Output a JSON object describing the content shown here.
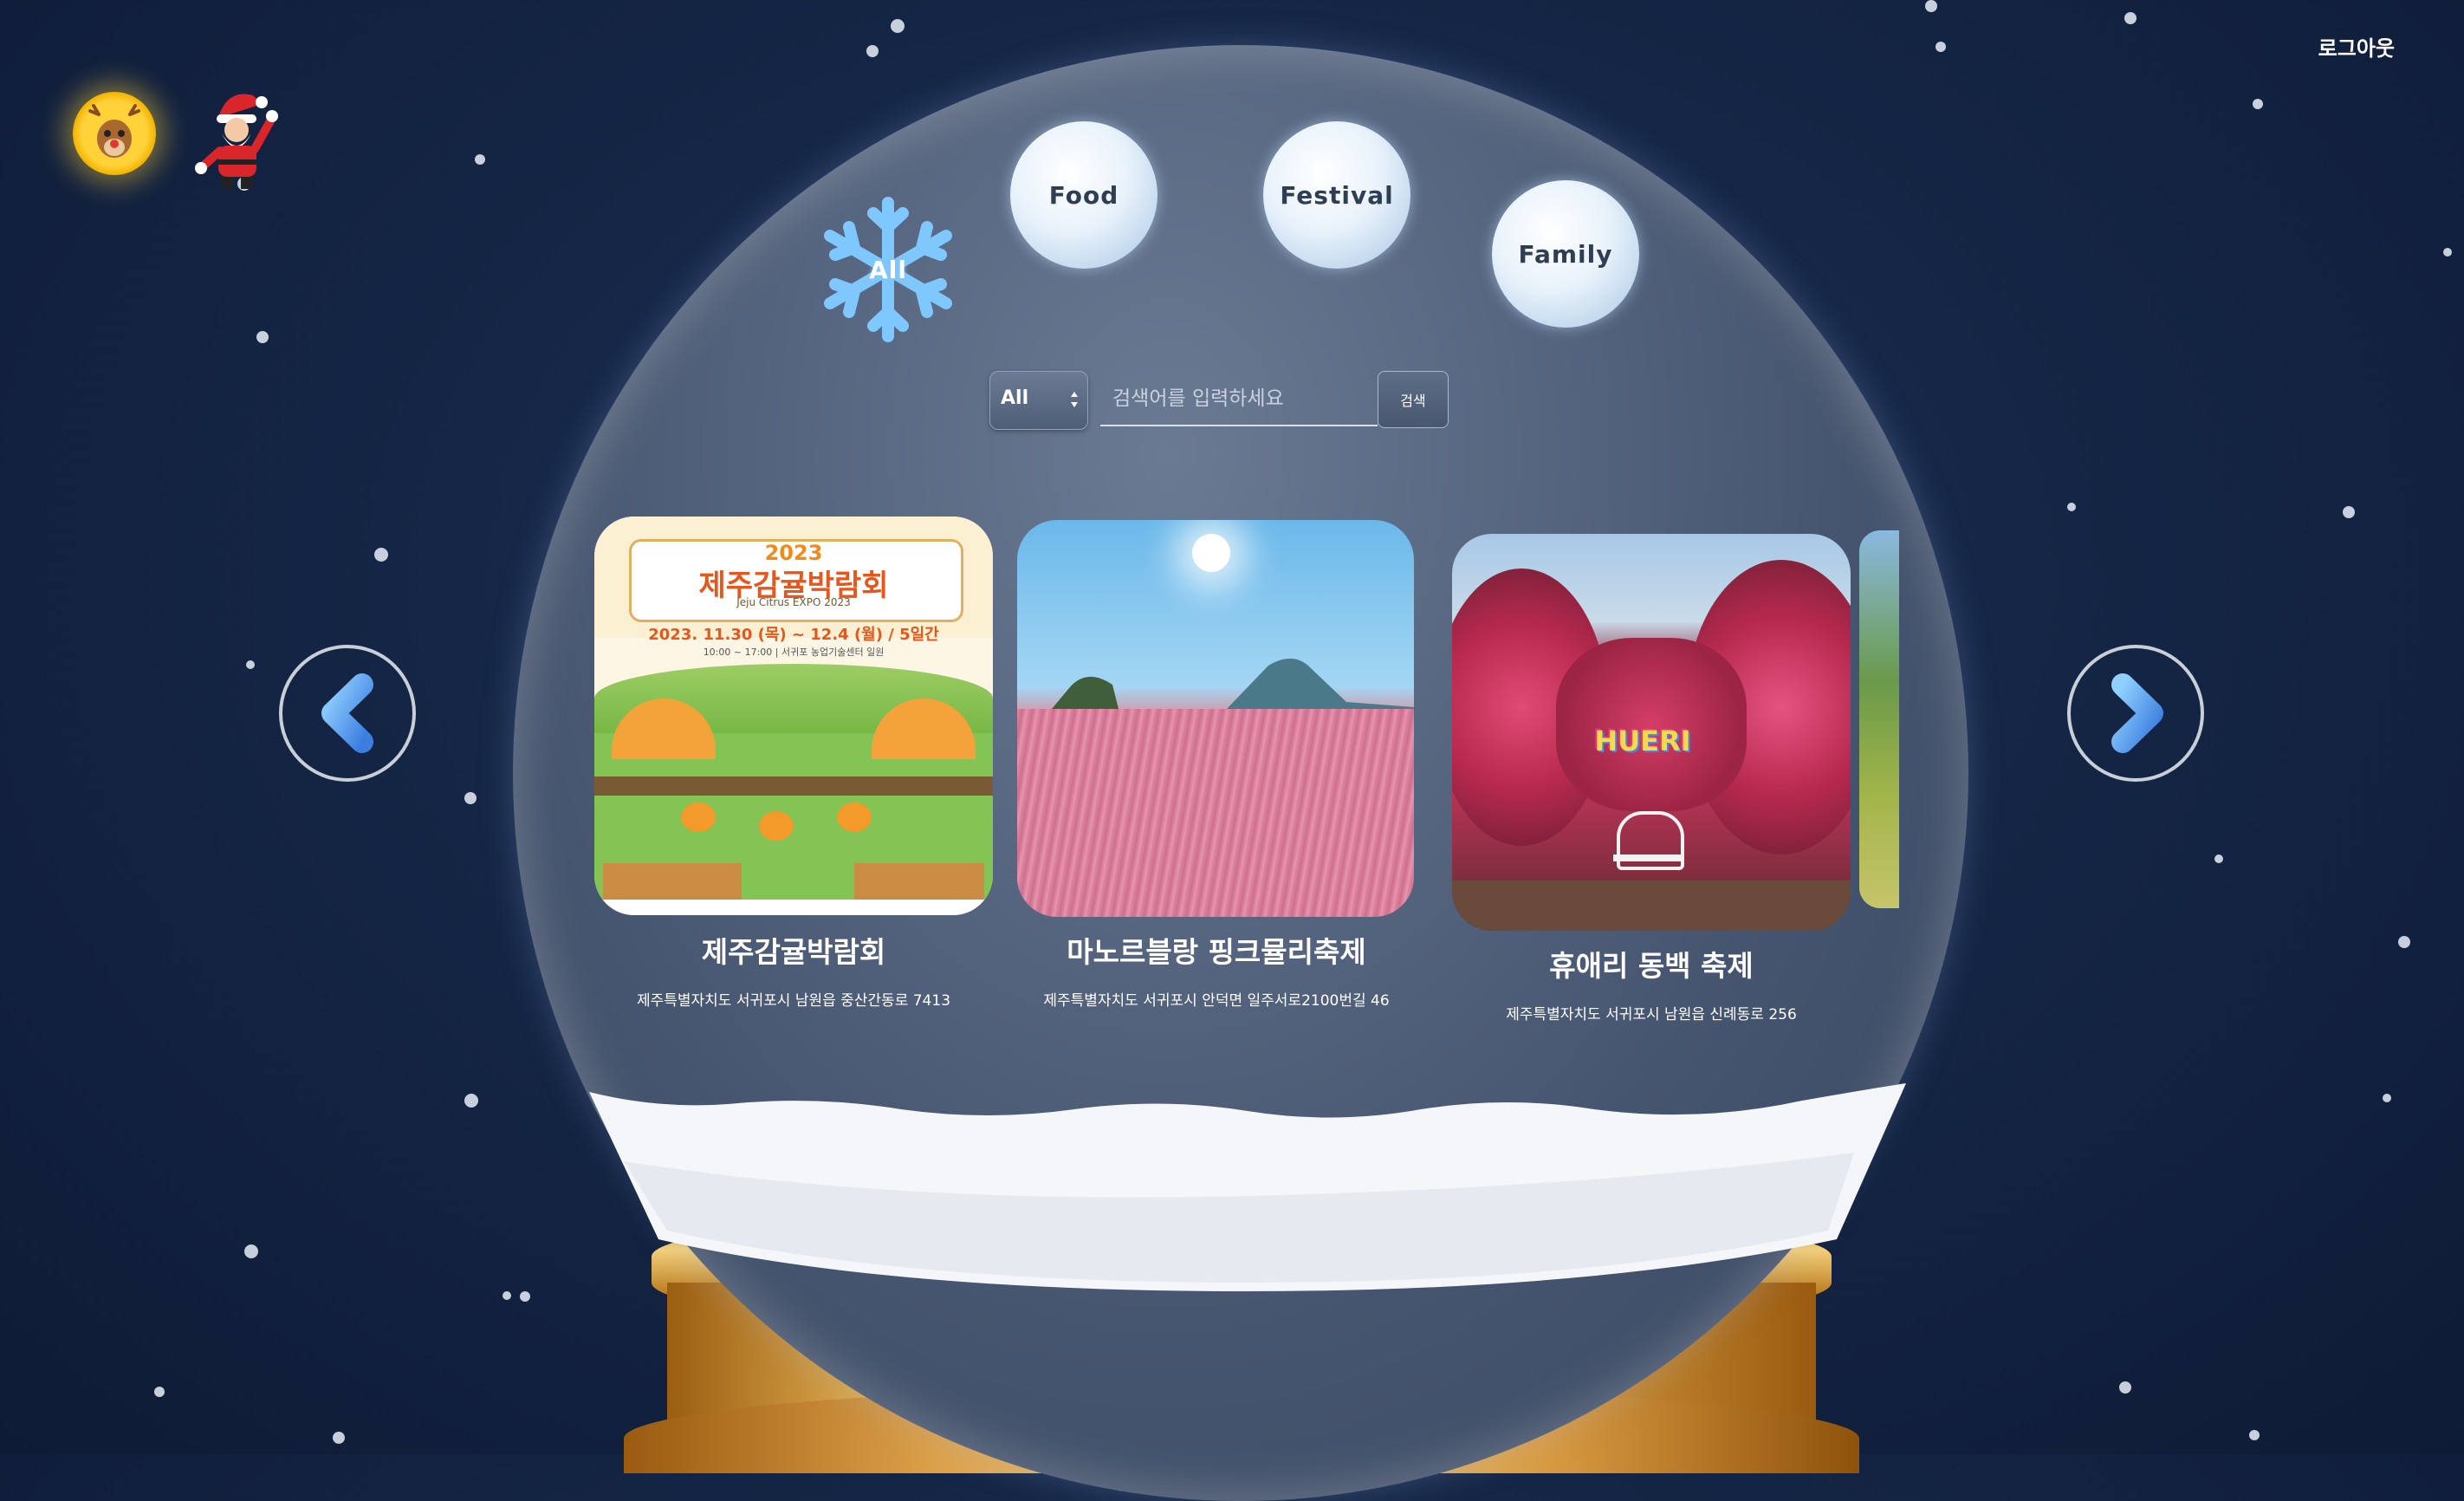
{
  "header": {
    "logout_label": "로그아웃"
  },
  "user": {
    "avatar": "reindeer-avatar",
    "mascot": "santa-claus"
  },
  "categories": [
    {
      "label": "All",
      "icon": "snowflake-icon"
    },
    {
      "label": "Food"
    },
    {
      "label": "Festival"
    },
    {
      "label": "Family"
    }
  ],
  "search": {
    "select_value": "All",
    "placeholder": "검색어를 입력하세요",
    "button_label": "검색"
  },
  "carousel": {
    "prev_icon": "chevron-left-icon",
    "next_icon": "chevron-right-icon",
    "cards": [
      {
        "title": "제주감귤박람회",
        "address": "제주특별자치도 서귀포시 남원읍 중산간동로 7413",
        "poster": {
          "year": "2023",
          "title": "제주감귤박람회",
          "subtitle": "Jeju Citrus EXPO 2023",
          "dates": "2023. 11.30 (목) ~ 12.4 (월) / 5일간",
          "time": "10:00 ~ 17:00 | 서귀포 농업기술센터 일원"
        }
      },
      {
        "title": "마노르블랑 핑크뮬리축제",
        "address": "제주특별자치도 서귀포시 안덕면 일주서로2100번길 46"
      },
      {
        "title": "휴애리 동백 축제",
        "address": "제주특별자치도 서귀포시 남원읍 신례동로 256",
        "sign_text": "HUERI"
      }
    ]
  },
  "colors": {
    "sky": "#152646",
    "accent_blue": "#5aa0ee",
    "gold": "#e8b656"
  }
}
